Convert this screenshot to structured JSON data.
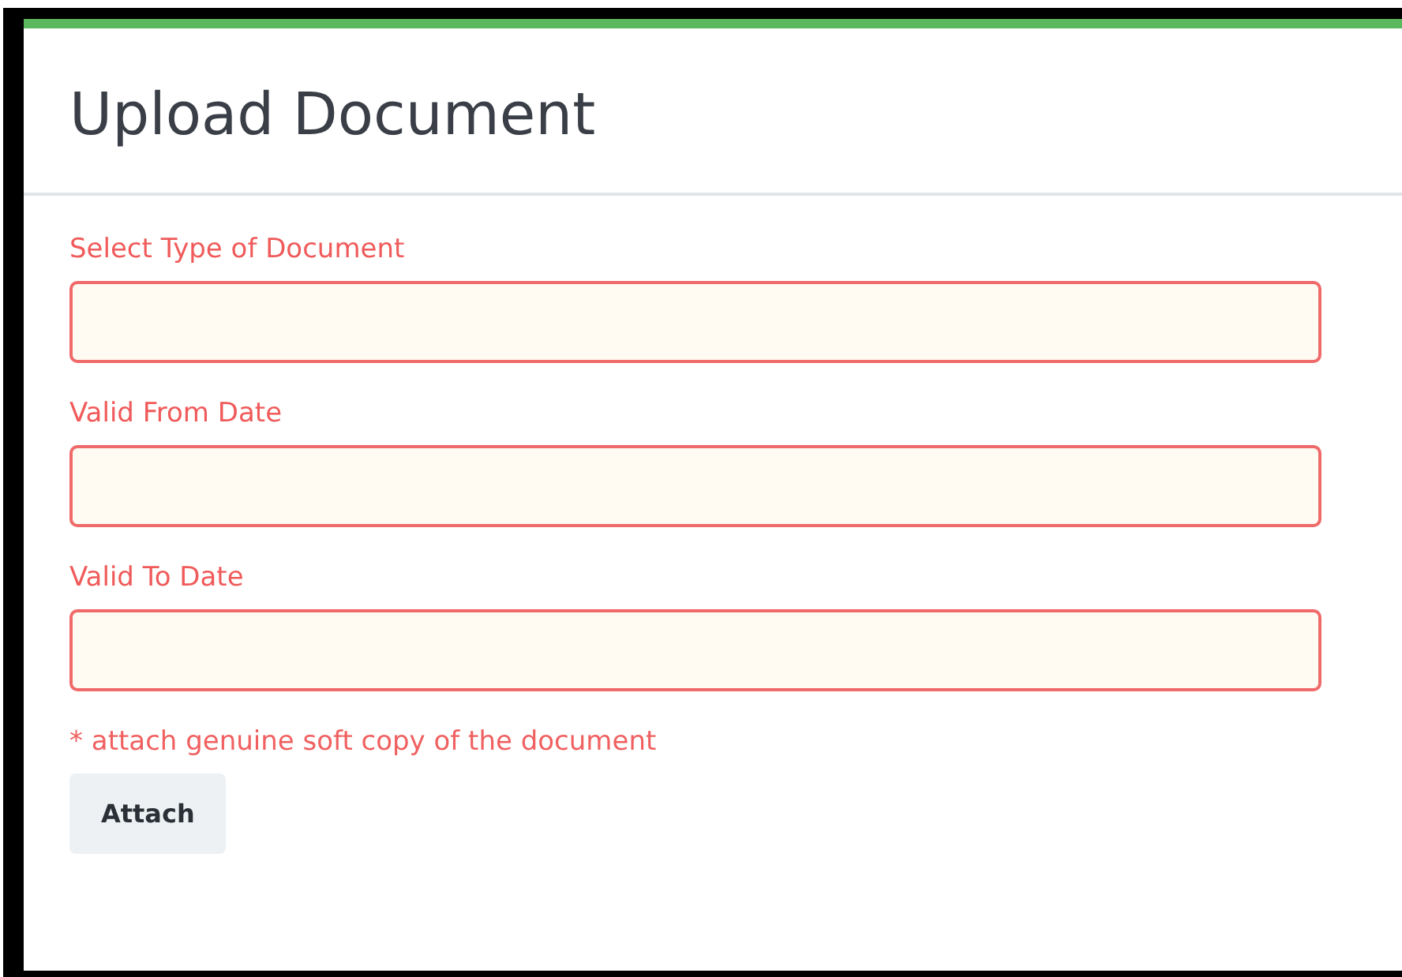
{
  "dialog": {
    "title": "Upload Document"
  },
  "fields": [
    {
      "label": "Select Type of Document",
      "invalid": true
    },
    {
      "label": "Valid From Date",
      "invalid": true
    },
    {
      "label": "Valid To Date",
      "invalid": true
    }
  ],
  "note": "* attach genuine soft copy of the document",
  "buttons": [
    "Attach"
  ]
}
